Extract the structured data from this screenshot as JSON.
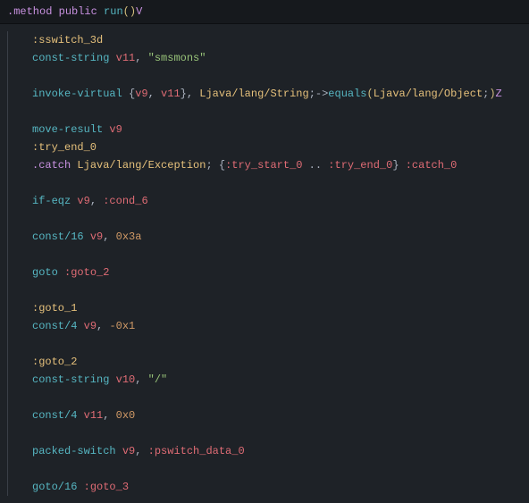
{
  "header": {
    "dot_method": ".method",
    "public": "public",
    "name": "run",
    "paren_open": "(",
    "paren_close": ")",
    "ret": "V"
  },
  "lines": {
    "l1_label": ":sswitch_3d",
    "l2_op": "const-string",
    "l2_reg": "v11",
    "l2_comma": ",",
    "l2_str": "\"smsmons\"",
    "l3_op": "invoke-virtual",
    "l3_brace_o": "{",
    "l3_r1": "v9",
    "l3_c1": ",",
    "l3_r2": "v11",
    "l3_brace_c": "}",
    "l3_c2": ",",
    "l3_cls": "Ljava/lang/String",
    "l3_semi": ";",
    "l3_arrow": "->",
    "l3_meth": "equals",
    "l3_po": "(",
    "l3_arg": "Ljava/lang/Object",
    "l3_semi2": ";",
    "l3_pc": ")",
    "l3_ret": "Z",
    "l4_op": "move-result",
    "l4_reg": "v9",
    "l5_label": ":try_end_0",
    "l6_dir": ".catch",
    "l6_cls": "Ljava/lang/Exception",
    "l6_semi": ";",
    "l6_bo": "{",
    "l6_s": ":try_start_0",
    "l6_dots": " .. ",
    "l6_e": ":try_end_0",
    "l6_bc": "}",
    "l6_h": ":catch_0",
    "l7_op": "if-eqz",
    "l7_reg": "v9",
    "l7_c": ",",
    "l7_t": ":cond_6",
    "l8_op": "const/16",
    "l8_reg": "v9",
    "l8_c": ",",
    "l8_n": "0x3a",
    "l9_op": "goto",
    "l9_t": ":goto_2",
    "l10_label": ":goto_1",
    "l11_op": "const/4",
    "l11_reg": "v9",
    "l11_c": ",",
    "l11_n": "-0x1",
    "l12_label": ":goto_2",
    "l13_op": "const-string",
    "l13_reg": "v10",
    "l13_c": ",",
    "l13_s": "\"/\"",
    "l14_op": "const/4",
    "l14_reg": "v11",
    "l14_c": ",",
    "l14_n": "0x0",
    "l15_op": "packed-switch",
    "l15_reg": "v9",
    "l15_c": ",",
    "l15_t": ":pswitch_data_0",
    "l16_op": "goto/16",
    "l16_t": ":goto_3"
  }
}
